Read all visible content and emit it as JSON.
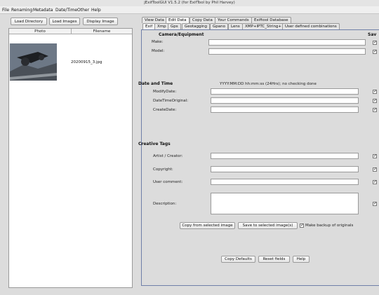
{
  "window": {
    "title": "jExifToolGUI V1.5.2  (for ExifTool by Phil Harvey)"
  },
  "menu": [
    "File",
    "Renaming",
    "Metadata",
    "Date/Time",
    "Other",
    "Help"
  ],
  "left_toolbar": {
    "load_directory": "Load Directory",
    "load_images": "Load Images",
    "display_image": "Display Image"
  },
  "file_table": {
    "headers": [
      "Photo",
      "Filename"
    ],
    "rows": [
      {
        "filename": "20200915_3.jpg"
      }
    ]
  },
  "main_tabs": [
    "View Data",
    "Edit Data",
    "Copy Data",
    "Your Commands",
    "Exiftool Database"
  ],
  "sub_tabs": [
    "Exif",
    "Xmp",
    "Gps",
    "Geotagging",
    "Gpano",
    "Lens",
    "XMP+IPTC_String+",
    "User defined combinations"
  ],
  "exif_edit": {
    "camera_section": "Camera/Equipment",
    "save_header": "Sav",
    "make_label": "Make:",
    "model_label": "Model:",
    "datetime_section": "Date and Time",
    "datetime_hint": "YYYY:MM:DD hh:mm:ss (24Hrs); no checking done",
    "modify_label": "ModifyDate:",
    "original_label": "DateTimeOriginal:",
    "create_label": "CreateDate:",
    "creative_section": "Creative Tags",
    "artist_label": "Artist / Creator:",
    "copyright_label": "Copyright:",
    "comment_label": "User comment:",
    "description_label": "Description:",
    "copy_from_button": "Copy from selected image",
    "save_to_button": "Save to selected image(s)",
    "backup_label": "Make backup of originals",
    "copy_defaults_button": "Copy Defaults",
    "reset_button": "Reset fields",
    "help_button": "Help"
  }
}
